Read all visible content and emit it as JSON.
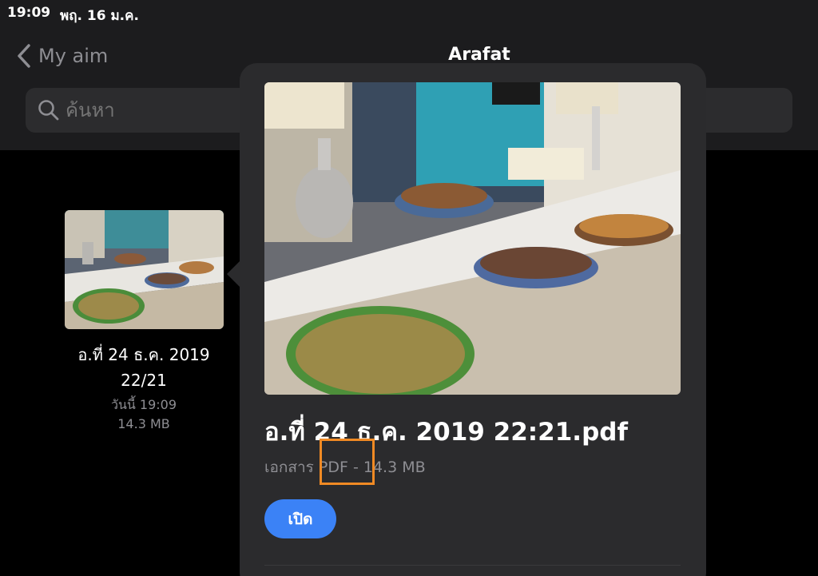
{
  "status_bar": {
    "time": "19:09",
    "date": "พฤ. 16 ม.ค."
  },
  "nav": {
    "back_label": "My aim",
    "title": "Arafat"
  },
  "search": {
    "placeholder": "ค้นหา"
  },
  "file": {
    "name_line1": "อ.ที่ 24 ธ.ค. 2019",
    "name_line2": "22/21",
    "date": "วันนี้ 19:09",
    "size": "14.3 MB"
  },
  "popover": {
    "title": "อ.ที่ 24 ธ.ค. 2019 22:21.pdf",
    "meta": "เอกสาร PDF - 14.3 MB",
    "open_label": "เปิด"
  },
  "colors": {
    "background": "#000000",
    "bar": "#1c1c1e",
    "popover": "#2b2b2d",
    "accent": "#3b82f6",
    "highlight": "#f08a24"
  }
}
